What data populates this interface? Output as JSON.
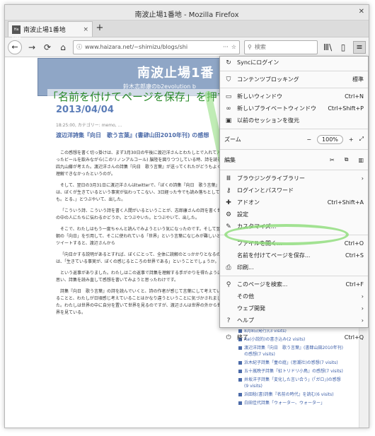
{
  "window": {
    "title": "南波止場1番地 - Mozilla Firefox"
  },
  "tab": {
    "favicon_text": "Ha nabe",
    "label": "南波止場1番地",
    "close": "×",
    "new_tab": "+"
  },
  "nav": {
    "back": "←",
    "forward": "→",
    "reload": "⟳",
    "home": "⌂",
    "url": "www.haizara.net/~shimizu/blogs/shi",
    "more": "···",
    "search_placeholder": "検索",
    "library": "Ⅲ\\",
    "sidebar": "▯",
    "menu": "≡"
  },
  "page": {
    "banner_title": "南波止場1番",
    "banner_subtitle": "鈴木志郎康のb2evolution  b",
    "annotation": "「名前を付けてページを保存」を押す",
    "date": "2013/04/04",
    "meta": "18:25:00, カテゴリー: memo, ...",
    "post_title": "渡辺洋詩集『向日　歌う言葉』(書肆山田2010年刊) の感想",
    "paragraphs": [
      "この感想を書く切っ掛けは、まず3月30日の午後に渡辺洋さんとわたしとで入れて入ったビールを飲みながら(このリノンアルコール) 脳陸を図りつつしている時、詩を読む四九山藤が考えた。渡辺洋さんの詩集『向日　歌う言葉』が送ってくれたがどうもよく理解できなかったというのが。",
      "そして、翌日の3月31日に渡辺洋さんはtwitterで、「ぼくの詩集『向日　歌う言葉』は、ぼくが生きているという事実が伝わってこない、3日経った今でも読み落ちとしても。とる、」とつぶやいて、出した。",
      "「こういう詩、こういう詩を書く人間がいるということが、志郎康さんの詩を書く世の中の人にたちに伝わるかどうか。とつぶやいた。とつぶやいて、出した。",
      "そこで、わたしはもう一度ちゃんと読んでみようという気になったのです。そして翌朝の「向日」を引用して、そこに使われている「世界」という言葉になじみが難しいとツイートすると、渡辺さんから",
      "「向日かする説明があるとすれば、ぼくにとって、全体に読解のとっかかりとなるのは、「生きている事実が、ぼくの感じるところの世界である」ということでしょうか。",
      "という返事がありました。わたしはこの返事で詩集を理解する手がかりを得たように思い、詩集を読み直して感想を書いてみようと思ったわけです。",
      "詩集『向日　歌う言葉』の詩を読んでいくと、詩の作者が感じて言葉にして考えていることと、わたしが日頃感じ考えていることはかなり違うということに気づかされました。わたしは世界の中に自分を置いて世界を見るのですが、渡辺さんは世界の外から世界を見ている。"
    ],
    "sidebar_links": [
      "8月8日発行)(3 visits)",
      "Ra(小説的)の書き込み(2 visits)",
      "渡辺洋詩集『向日　歌う言葉』(書肆山田2010年刊)の感想(7 visits)",
      "浜木紀子詩集「壷の庭」(思潮社)の感想(7 visits)",
      "五十嵐晩子詩集『虹トリドリ小鳥』の感想(7 visits)",
      "井坂洋子詩集「変化した言い合う」(「ガロ」)の感想(9 visits)",
      "浜田稔(書)詩集『名前の時代』を読む(6 visits)",
      "白田佳代詩集「ウォーター、ウォーター」"
    ]
  },
  "menu": {
    "sync": "Syncにログイン",
    "content_blocking": "コンテンツブロッキング",
    "content_blocking_value": "標準",
    "new_window": "新しいウィンドウ",
    "new_window_sc": "Ctrl+N",
    "new_private": "新しいプライベートウィンドウ",
    "new_private_sc": "Ctrl+Shift+P",
    "restore": "以前のセッションを復元",
    "zoom": "ズーム",
    "zoom_minus": "−",
    "zoom_value": "100%",
    "zoom_plus": "+",
    "zoom_full": "⤢",
    "edit": "編集",
    "cut": "✂",
    "copy": "⧉",
    "paste": "▥",
    "library": "ブラウジングライブラリー",
    "logins": "ログインとパスワード",
    "addons": "アドオン",
    "addons_sc": "Ctrl+Shift+A",
    "settings": "設定",
    "customize": "カスタマイズ...",
    "open_file": "ファイルを開く...",
    "open_file_sc": "Ctrl+O",
    "save_as": "名前を付けてページを保存...",
    "save_as_sc": "Ctrl+S",
    "print": "印刷...",
    "find": "このページを検索...",
    "find_sc": "Ctrl+F",
    "more": "その他",
    "web_dev": "ウェブ開発",
    "help": "ヘルプ",
    "quit": "終了",
    "quit_sc": "Ctrl+Q",
    "arrow": "›"
  }
}
